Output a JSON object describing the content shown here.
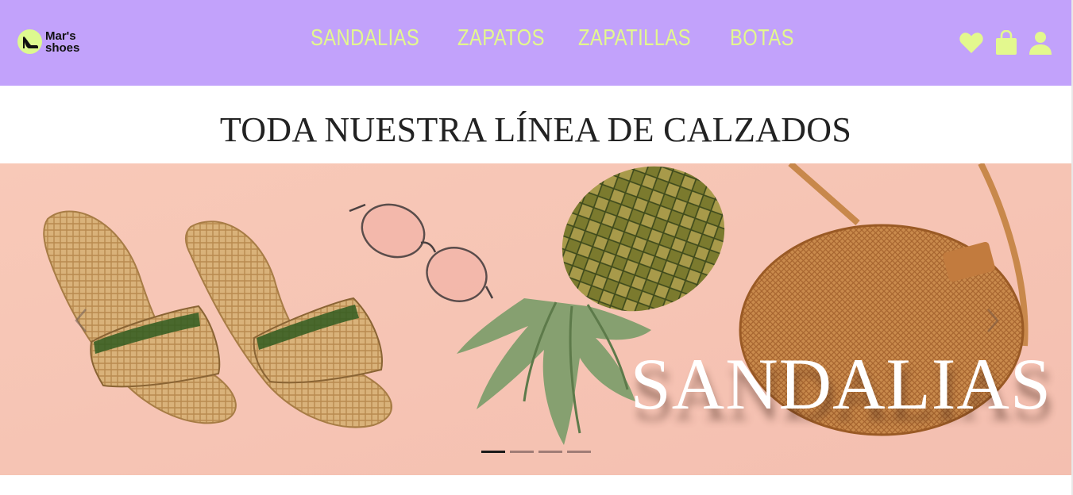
{
  "brand": {
    "line1": "Mar's",
    "line2": "shoes"
  },
  "nav": {
    "links": [
      "SANDALIAS",
      "ZAPATOS",
      "ZAPATILLAS",
      "BOTAS"
    ]
  },
  "icons": [
    "heart-icon",
    "shopping-bag-icon",
    "user-icon"
  ],
  "section": {
    "title": "TODA NUESTRA LÍNEA DE CALZADOS"
  },
  "carousel": {
    "caption": "SANDALIAS",
    "slide_count": 4,
    "active_index": 0
  },
  "colors": {
    "navbar": "#c2a2fb",
    "accent": "#e3f88e",
    "slide_background": "#f7c8b6"
  }
}
